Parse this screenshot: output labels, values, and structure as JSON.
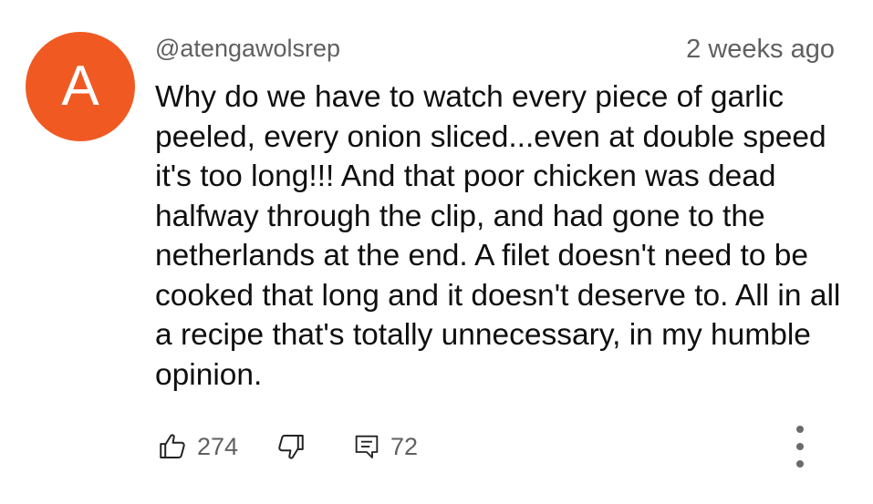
{
  "comment": {
    "avatar_letter": "A",
    "avatar_color": "#f05a22",
    "author": "@atengawolsrep",
    "timestamp": "2 weeks ago",
    "text": "Why do we have to watch every piece of garlic peeled, every onion sliced...even at double speed it's too long!!! And that poor chicken was dead halfway through the clip, and had gone to the netherlands at the end. A filet doesn't need to be cooked that long and it doesn't deserve to. All in all a recipe that's totally unnecessary, in my humble opinion.",
    "likes": "274",
    "replies": "72"
  },
  "icons": {
    "like": "thumbs-up-icon",
    "dislike": "thumbs-down-icon",
    "reply": "comment-reply-icon",
    "more": "more-vertical-icon"
  }
}
